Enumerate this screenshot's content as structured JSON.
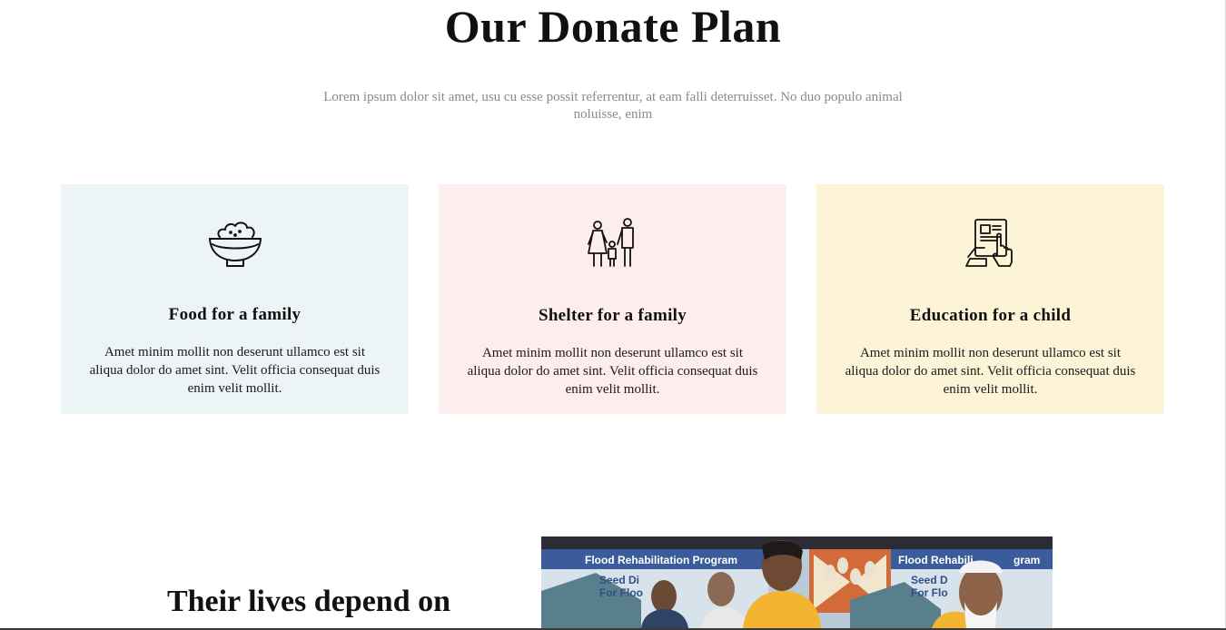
{
  "donate_section": {
    "title": "Our Donate Plan",
    "subtitle": "Lorem ipsum dolor sit amet, usu cu esse possit referrentur, at eam falli deterruisset. No duo populo animal noluisse, enim"
  },
  "cards": [
    {
      "icon": "food-bowl-icon",
      "title": "Food for a family",
      "text": "Amet minim mollit non deserunt ullamco est sit aliqua dolor do amet sint. Velit officia consequat duis enim velit mollit.",
      "background": "#ecf4f5"
    },
    {
      "icon": "family-icon",
      "title": "Shelter for a family",
      "text": "Amet minim mollit non deserunt ullamco est sit aliqua dolor do amet sint. Velit officia consequat duis enim velit mollit.",
      "background": "#fdeeed"
    },
    {
      "icon": "education-tablet-icon",
      "title": "Education for a child",
      "text": "Amet minim mollit non deserunt ullamco est sit aliqua dolor do amet sint. Velit officia consequat duis enim velit mollit.",
      "background": "#fdf4d7"
    }
  ],
  "lives_section": {
    "heading": "Their lives depend on",
    "photo": {
      "banner_left": "Flood Rehabilitation Program",
      "banner_left_sub1": "Seed Di",
      "banner_left_sub2": "For Floo",
      "banner_right": "Flood Rehabili",
      "banner_right_suffix": "gram",
      "banner_right_sub1": "Seed D",
      "banner_right_sub2": "For Flo"
    }
  }
}
